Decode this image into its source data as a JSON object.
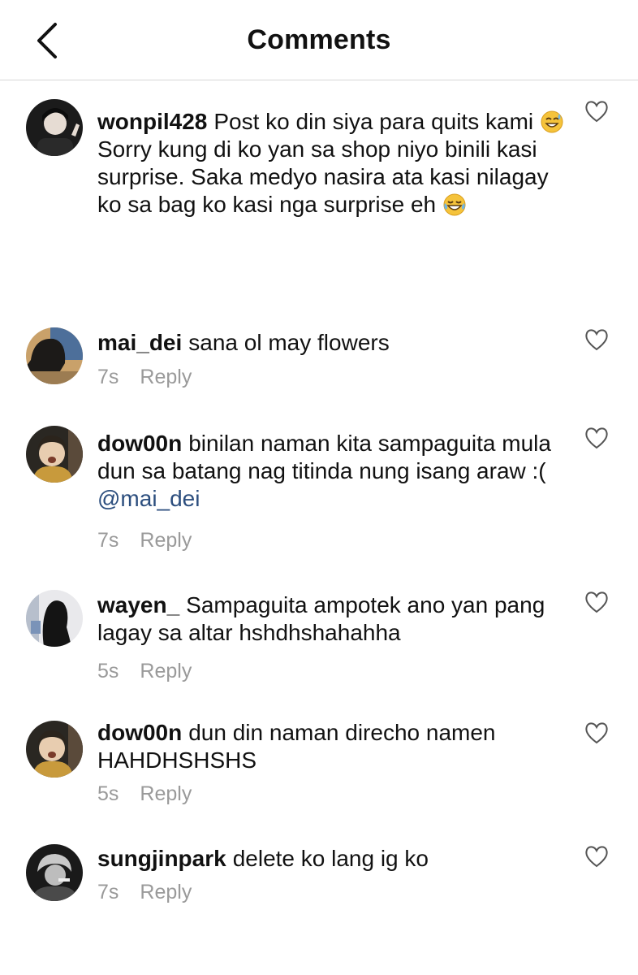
{
  "header": {
    "title": "Comments",
    "back_icon": "chevron-left-icon"
  },
  "comments": [
    {
      "username": "wonpil428",
      "text1": "Post ko din siya para quits kami ",
      "emoji1": "grinning-sweat-emoji",
      "text2": " Sorry kung di ko yan sa shop niyo binili kasi surprise. Saka medyo nasira ata kasi nilagay ko sa bag ko kasi nga surprise eh ",
      "emoji2": "tears-of-joy-emoji"
    },
    {
      "username": "mai_dei",
      "text": "sana ol may flowers",
      "time": "7s",
      "reply": "Reply"
    },
    {
      "username": "dow00n",
      "text": "binilan naman kita sampaguita mula dun sa batang nag titinda nung isang araw :( ",
      "mention": "@mai_dei",
      "time": "7s",
      "reply": "Reply"
    },
    {
      "username": "wayen_",
      "text": "Sampaguita ampotek ano yan pang lagay sa altar hshdhshahahha",
      "time": "5s",
      "reply": "Reply"
    },
    {
      "username": "dow00n",
      "text": "dun din naman direcho namen HAHDHSHSHS",
      "time": "5s",
      "reply": "Reply"
    },
    {
      "username": "sungjinpark",
      "text": "delete ko lang ig ko",
      "time": "7s",
      "reply": "Reply"
    }
  ],
  "colors": {
    "mention": "#2c4e7e",
    "meta": "#9a9a9a",
    "divider": "#d6d6d6"
  }
}
